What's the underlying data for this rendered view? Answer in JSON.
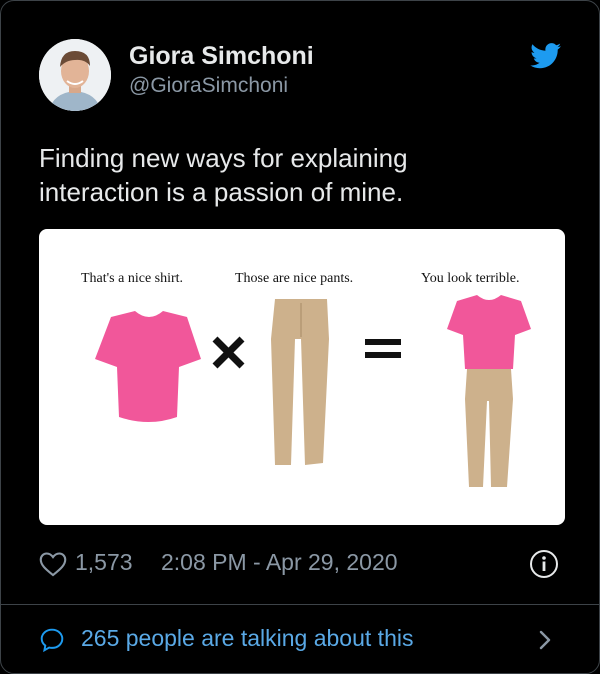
{
  "tweet": {
    "author_name": "Giora Simchoni",
    "author_handle": "@GioraSimchoni",
    "text": "Finding new ways for explaining\ninteraction is a passion of mine.",
    "media": {
      "caption_shirt": "That's a nice shirt.",
      "caption_pants": "Those are nice pants.",
      "caption_result": "You look terrible.",
      "times_symbol": "×",
      "equals_symbol": "="
    },
    "like_count": "1,573",
    "timestamp": "2:08 PM - Apr 29, 2020",
    "talking_text": "265 people are talking about this"
  },
  "colors": {
    "background": "#000000",
    "accent_blue": "#1d9bf0",
    "link_blue": "#5aa9e6",
    "muted_text": "#8b98a5",
    "shirt_pink": "#f1579a",
    "pants_khaki": "#cdb18c"
  },
  "icons": {
    "brand": "twitter-bird-icon",
    "like": "heart-outline-icon",
    "info": "info-circle-icon",
    "reply": "speech-bubble-icon",
    "more": "chevron-right-icon"
  }
}
